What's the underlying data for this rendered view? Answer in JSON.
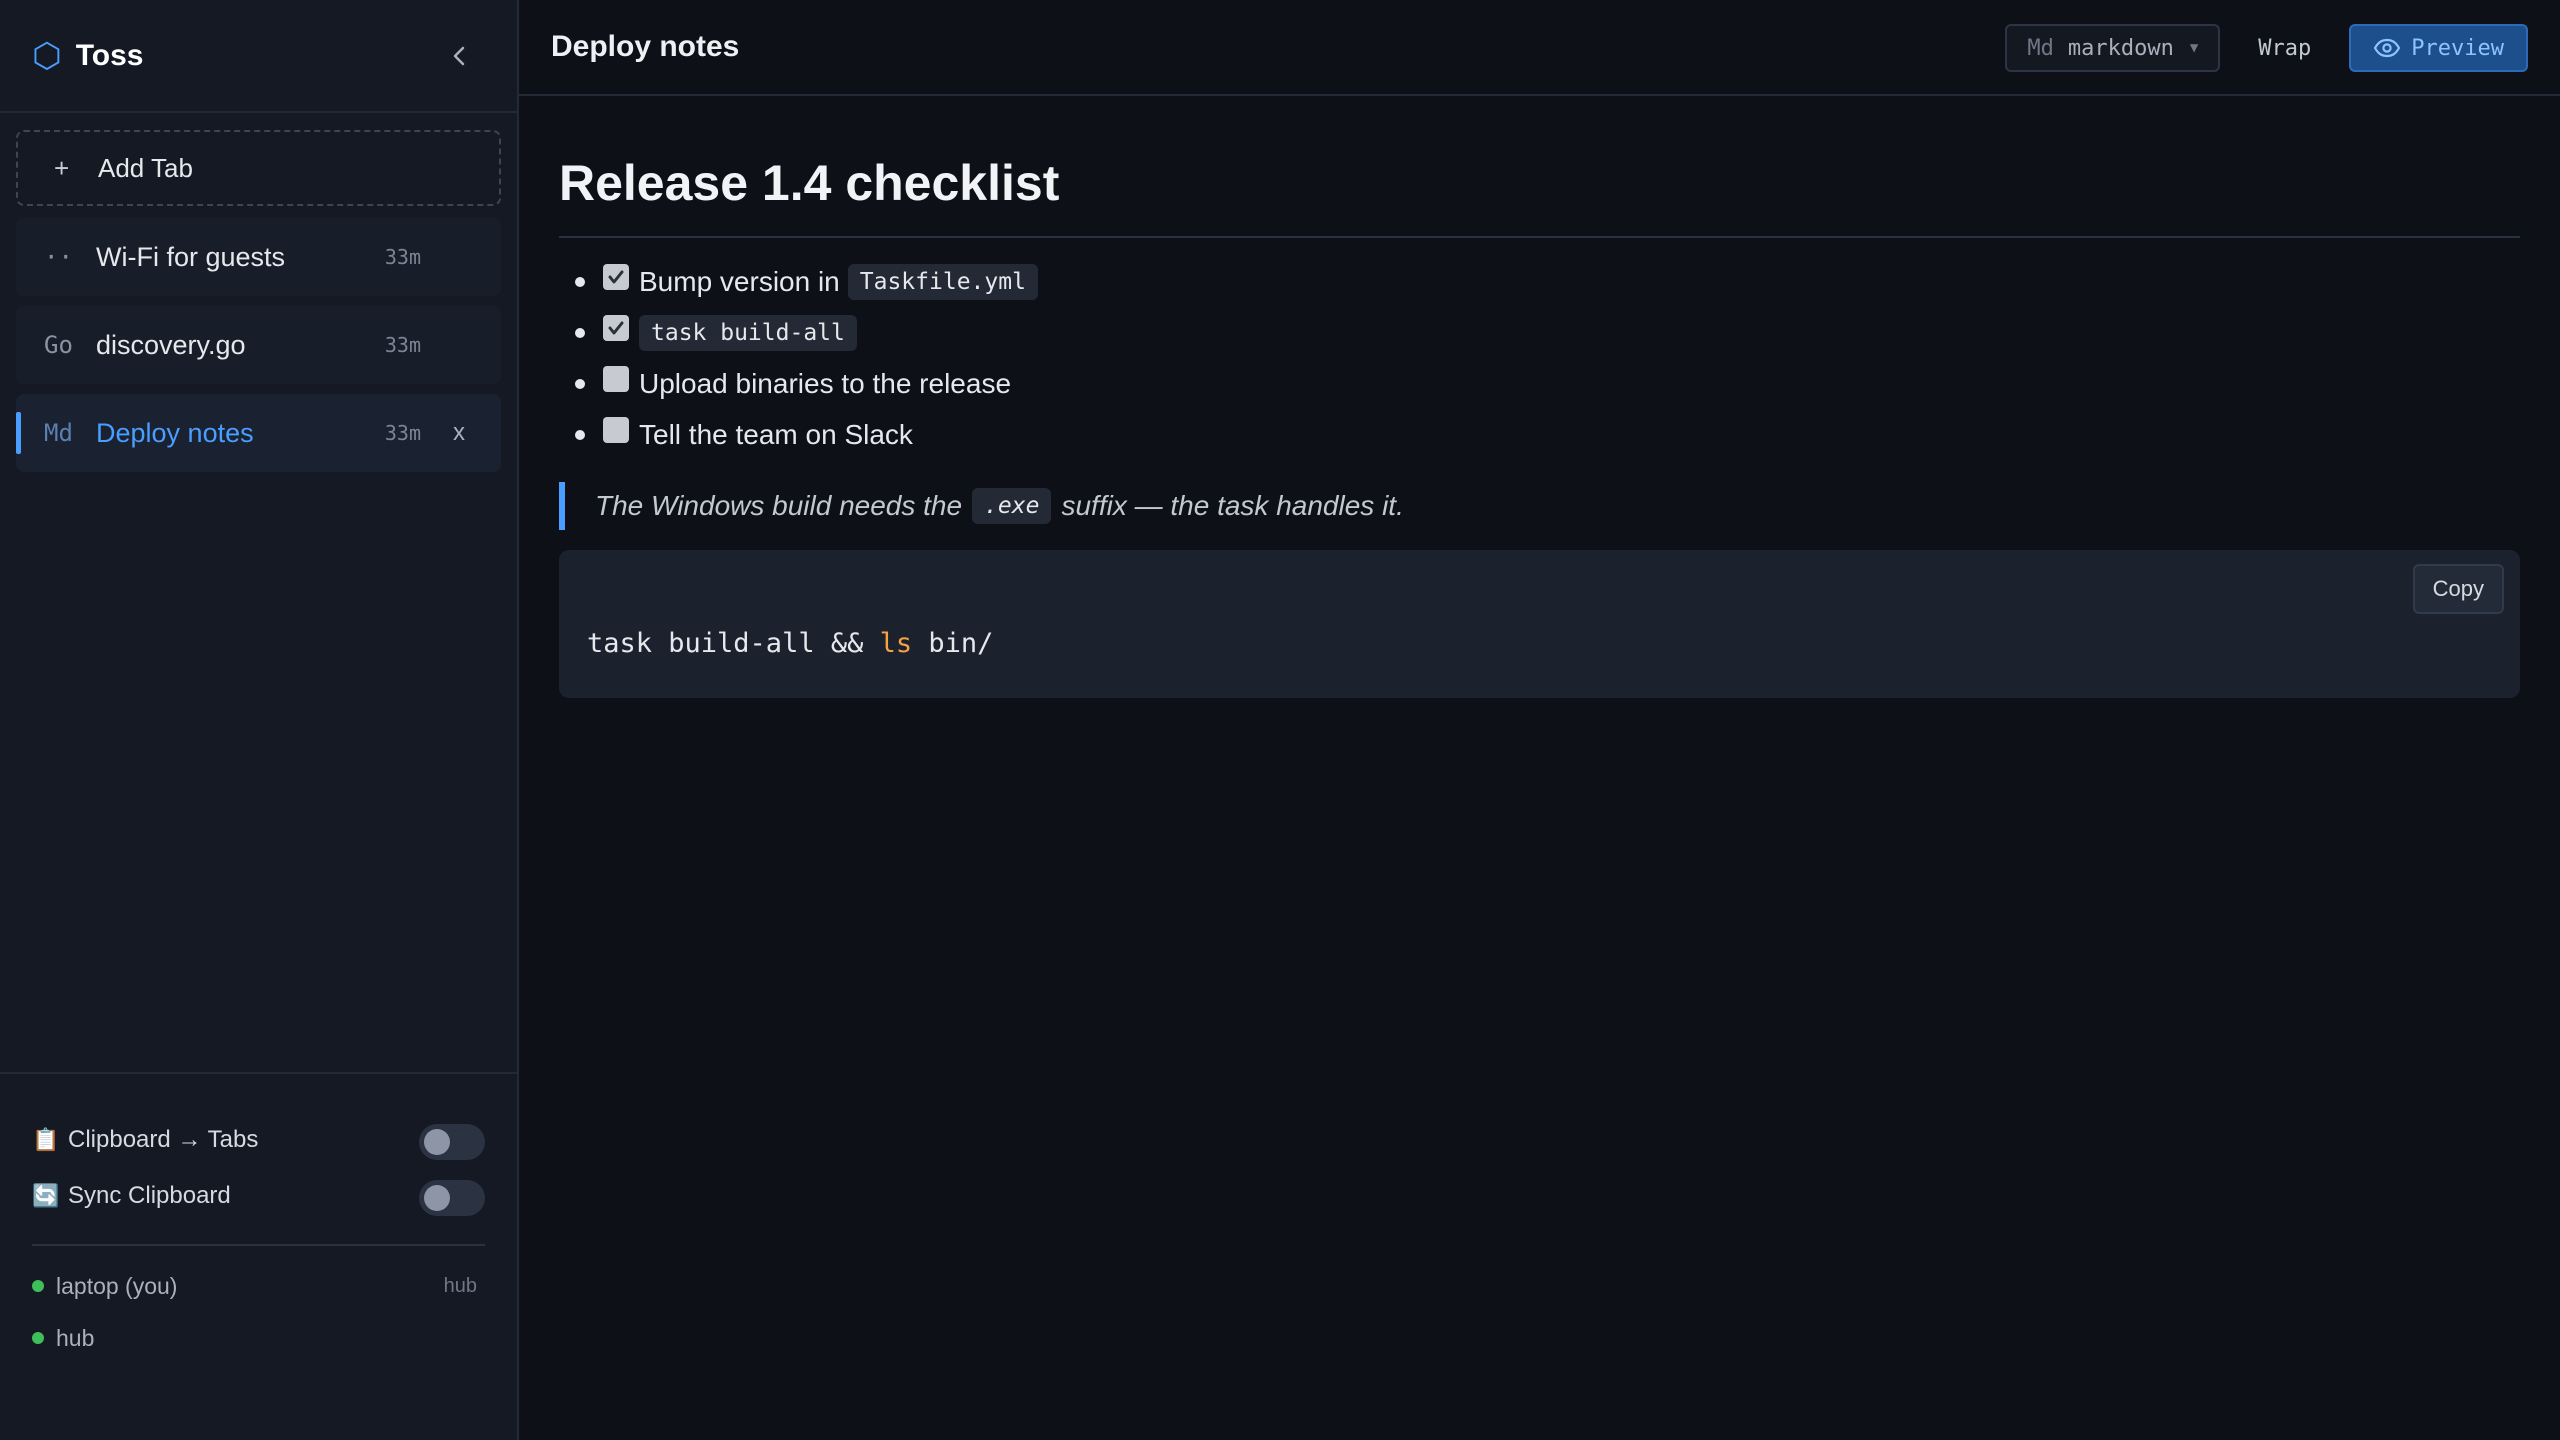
{
  "sidebar": {
    "brand": {
      "icon": "hexagon-icon",
      "name": "Toss",
      "accent": "#4a9eff"
    },
    "add_tab_label": "Add Tab",
    "tabs": [
      {
        "kind": "··",
        "title": "Wi-Fi for guests",
        "age": "33m",
        "active": false
      },
      {
        "kind": "Go",
        "title": "discovery.go",
        "age": "33m",
        "active": false
      },
      {
        "kind": "Md",
        "title": "Deploy notes",
        "age": "33m",
        "active": true,
        "close": "x"
      }
    ],
    "toggles": [
      {
        "emoji": "📋",
        "label": "Clipboard → Tabs",
        "on": false
      },
      {
        "emoji": "🔄",
        "label": "Sync Clipboard",
        "on": false
      }
    ],
    "peers": [
      {
        "name": "laptop (you)",
        "tag": "hub",
        "status_color": "#3fbf5a"
      },
      {
        "name": "hub",
        "tag": "",
        "status_color": "#3fbf5a"
      }
    ]
  },
  "main": {
    "title": "Deploy notes",
    "language": {
      "prefix": "Md",
      "value": "markdown"
    },
    "wrap_label": "Wrap",
    "preview_label": "Preview",
    "doc": {
      "heading": "Release 1.4 checklist",
      "checklist": [
        {
          "checked": true,
          "text": "Bump version in",
          "code": "Taskfile.yml"
        },
        {
          "checked": true,
          "text": "",
          "code": "task build-all"
        },
        {
          "checked": false,
          "text": "Upload binaries to the release",
          "code": ""
        },
        {
          "checked": false,
          "text": "Tell the team on Slack",
          "code": ""
        }
      ],
      "quote": {
        "before": "The Windows build needs the",
        "code": ".exe",
        "after": "suffix — the task handles it."
      },
      "code": {
        "part1": "task build-all && ",
        "keyword": "ls",
        "part2": " bin/",
        "copy_label": "Copy"
      }
    }
  }
}
